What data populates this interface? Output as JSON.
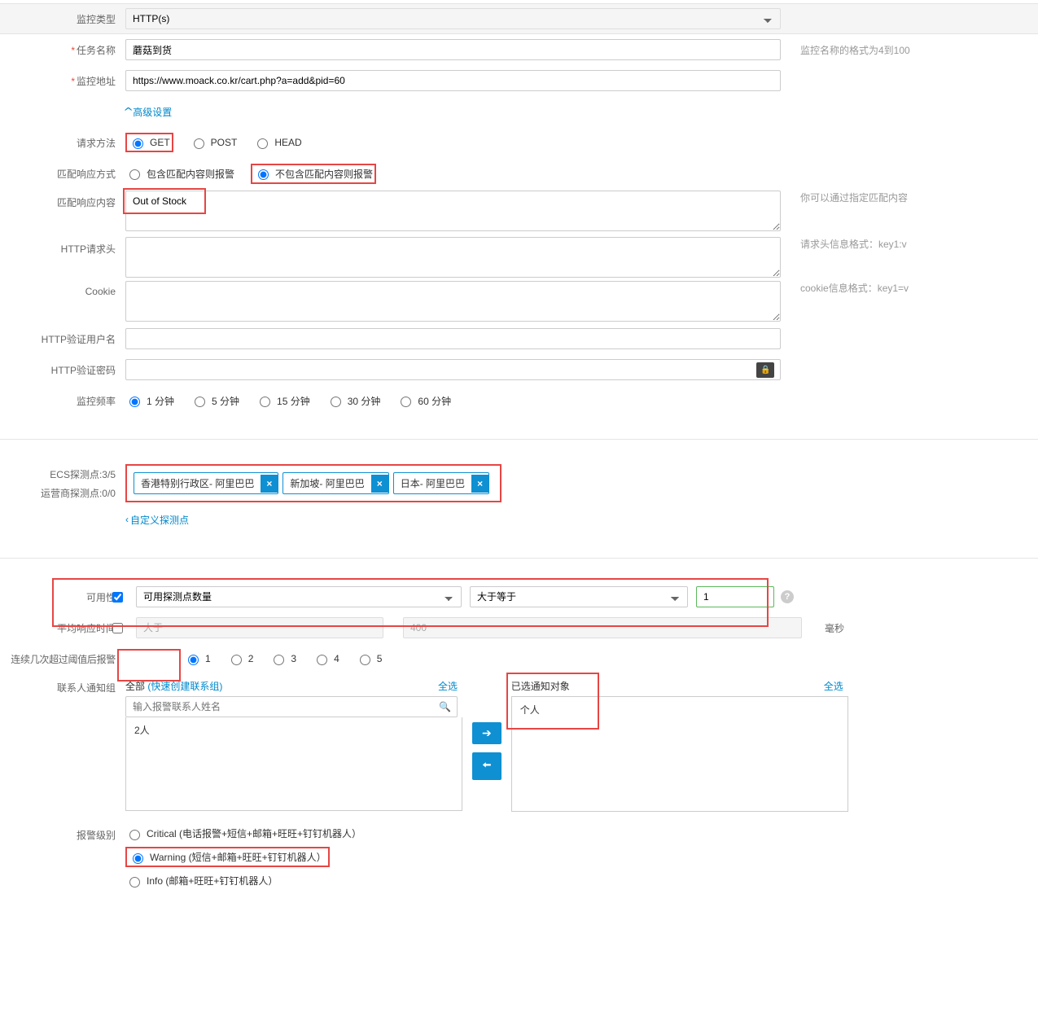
{
  "section1": {
    "monitor_type_label": "监控类型",
    "monitor_type_value": "HTTP(s)",
    "task_name_label": "任务名称",
    "task_name_value": "蘑菇到货",
    "task_name_help": "监控名称的格式为4到100",
    "monitor_addr_label": "监控地址",
    "monitor_addr_value": "https://www.moack.co.kr/cart.php?a=add&pid=60",
    "advanced_link": "高级设置",
    "request_method_label": "请求方法",
    "request_methods": {
      "get": "GET",
      "post": "POST",
      "head": "HEAD"
    },
    "match_mode_label": "匹配响应方式",
    "match_modes": {
      "include": "包含匹配内容则报警",
      "exclude": "不包含匹配内容则报警"
    },
    "match_content_label": "匹配响应内容",
    "match_content_value": "Out of Stock",
    "match_content_help": "你可以通过指定匹配内容",
    "http_headers_label": "HTTP请求头",
    "http_headers_help": "请求头信息格式：key1:v",
    "cookie_label": "Cookie",
    "cookie_help": "cookie信息格式：key1=v",
    "http_user_label": "HTTP验证用户名",
    "http_pass_label": "HTTP验证密码",
    "monitor_freq_label": "监控频率",
    "freq_options": {
      "f1": "1 分钟",
      "f5": "5 分钟",
      "f15": "15 分钟",
      "f30": "30 分钟",
      "f60": "60 分钟"
    }
  },
  "section2": {
    "ecs_probe_label": "ECS探测点:3/5",
    "isp_probe_label": "运营商探测点:0/0",
    "tags": [
      "香港特别行政区- 阿里巴巴",
      "新加坡- 阿里巴巴",
      "日本- 阿里巴巴"
    ],
    "custom_probe_link": "自定义探测点"
  },
  "section3": {
    "availability_label": "可用性",
    "availability_metric": "可用探测点数量",
    "availability_op": "大于等于",
    "availability_value": "1",
    "avg_resp_label": "平均响应时间",
    "avg_resp_op": "大于",
    "avg_resp_value": "400",
    "avg_resp_unit": "毫秒",
    "consecutive_label": "连续几次超过阈值后报警",
    "consecutive_options": [
      "1",
      "2",
      "3",
      "4",
      "5"
    ],
    "contact_group_label": "联系人通知组",
    "all_text": "全部",
    "quick_create_text": "(快速创建联系组)",
    "select_all_text": "全选",
    "search_placeholder": "输入报警联系人姓名",
    "left_items": [
      "2人"
    ],
    "selected_header": "已选通知对象",
    "right_items": [
      "个人"
    ],
    "alert_level_label": "报警级别",
    "alert_levels": {
      "critical": "Critical (电话报警+短信+邮箱+旺旺+钉钉机器人）",
      "warning": "Warning (短信+邮箱+旺旺+钉钉机器人）",
      "info": "Info (邮箱+旺旺+钉钉机器人）"
    }
  }
}
